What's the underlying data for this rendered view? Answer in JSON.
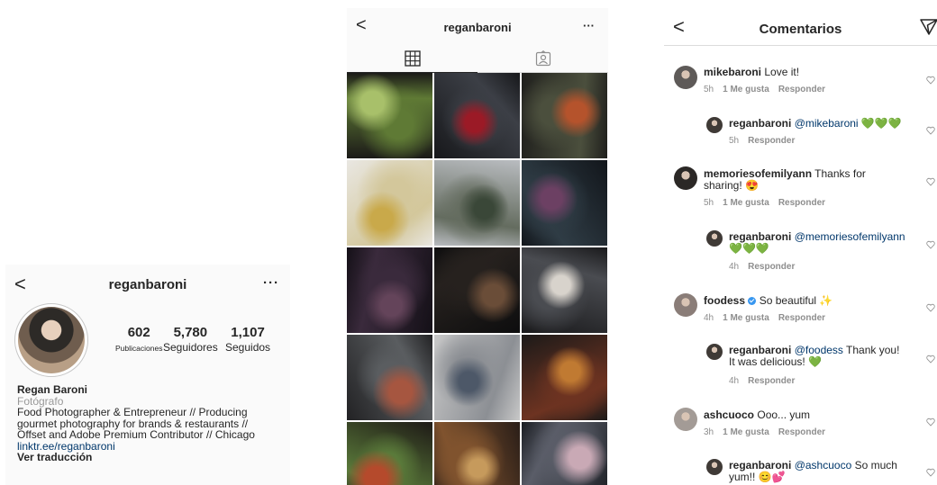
{
  "profile": {
    "back": "<",
    "username": "reganbaroni",
    "more": "···",
    "stats": [
      {
        "value": "602",
        "label": "Publicaciones"
      },
      {
        "value": "5,780",
        "label": "Seguidores"
      },
      {
        "value": "1,107",
        "label": "Seguidos"
      }
    ],
    "name": "Regan Baroni",
    "category": "Fotógrafo",
    "bio_line1": "Food Photographer & Entrepreneur // Producing",
    "bio_line2": "gourmet photography for brands & restaurants //",
    "bio_line3": "Offset and Adobe Premium Contributor // Chicago",
    "link": "linktr.ee/reganbaroni",
    "translate": "Ver traducción"
  },
  "grid": {
    "back": "<",
    "username": "reganbaroni",
    "more": "···",
    "tabs": [
      {
        "icon": "grid-icon",
        "active": true
      },
      {
        "icon": "tagged-icon",
        "active": false
      }
    ],
    "photos": [
      {
        "subject": "green soup",
        "colors": [
          "#1b1a18",
          "#5f7a35",
          "#a8c06a"
        ]
      },
      {
        "subject": "red wine glass",
        "colors": [
          "#17181b",
          "#3c3f46",
          "#9b1a26"
        ]
      },
      {
        "subject": "radishes",
        "colors": [
          "#20201d",
          "#4b4f3d",
          "#b5532c"
        ]
      },
      {
        "subject": "lemons and wine",
        "colors": [
          "#e9e7e2",
          "#d3c79b",
          "#c9a94a"
        ]
      },
      {
        "subject": "artichokes",
        "colors": [
          "#b9bcc0",
          "#646c5f",
          "#3a4738"
        ]
      },
      {
        "subject": "purple flowers",
        "colors": [
          "#12161b",
          "#2f3c45",
          "#6c4063"
        ]
      },
      {
        "subject": "kale leaves",
        "colors": [
          "#141017",
          "#3a2a3c",
          "#64445a"
        ]
      },
      {
        "subject": "bread",
        "colors": [
          "#0d0d0e",
          "#26211e",
          "#6a4d38"
        ]
      },
      {
        "subject": "mussels",
        "colors": [
          "#1a1a1c",
          "#4a4c51",
          "#d8d3cc"
        ]
      },
      {
        "subject": "tart plate",
        "colors": [
          "#222224",
          "#5a5d60",
          "#a65640"
        ]
      },
      {
        "subject": "blue eggs",
        "colors": [
          "#c8c8c8",
          "#8c8f94",
          "#4d5868"
        ]
      },
      {
        "subject": "tomatoes",
        "colors": [
          "#1c1a19",
          "#6d3321",
          "#c07a32"
        ]
      },
      {
        "subject": "sliced tomato",
        "colors": [
          "#1e1a16",
          "#5a7a3a",
          "#b54a2c"
        ]
      },
      {
        "subject": "pizza",
        "colors": [
          "#2a1e18",
          "#80532e",
          "#c69a5c"
        ]
      },
      {
        "subject": "macarons",
        "colors": [
          "#1a1d22",
          "#5a5d68",
          "#c9a9b5"
        ]
      }
    ]
  },
  "comments": {
    "back": "<",
    "title": "Comentarios",
    "items": [
      {
        "user": "mikebaroni",
        "text": "Love it!",
        "time": "5h",
        "likes": "1 Me gusta",
        "reply": "Responder",
        "is_reply": false,
        "avatar_color": "#5e5a58"
      },
      {
        "user": "reganbaroni",
        "mention": "@mikebaroni",
        "text": "💚💚💚",
        "time": "5h",
        "reply": "Responder",
        "is_reply": true,
        "avatar_color": "#3f3a36"
      },
      {
        "user": "memoriesofemilyann",
        "text": "Thanks for",
        "text2": "sharing! 😍",
        "time": "5h",
        "likes": "1 Me gusta",
        "reply": "Responder",
        "is_reply": false,
        "avatar_color": "#2b2826"
      },
      {
        "user": "reganbaroni",
        "mention": "@memoriesofemilyann",
        "text2": "💚💚💚",
        "time": "4h",
        "reply": "Responder",
        "is_reply": true,
        "avatar_color": "#3f3a36"
      },
      {
        "user": "foodess",
        "text": "So beautiful ✨",
        "time": "4h",
        "likes": "1 Me gusta",
        "reply": "Responder",
        "is_reply": false,
        "verified": true,
        "avatar_color": "#8a7d78"
      },
      {
        "user": "reganbaroni",
        "mention": "@foodess",
        "text": "Thank you!",
        "text2": "It was delicious! 💚",
        "time": "4h",
        "reply": "Responder",
        "is_reply": true,
        "avatar_color": "#3f3a36"
      },
      {
        "user": "ashcuoco",
        "text": "Ooo... yum",
        "time": "3h",
        "likes": "1 Me gusta",
        "reply": "Responder",
        "is_reply": false,
        "avatar_color": "#a39b96"
      },
      {
        "user": "reganbaroni",
        "mention": "@ashcuoco",
        "text": "So much",
        "text2": "yum!! 😊💕",
        "is_reply": true,
        "avatar_color": "#3f3a36"
      }
    ]
  }
}
